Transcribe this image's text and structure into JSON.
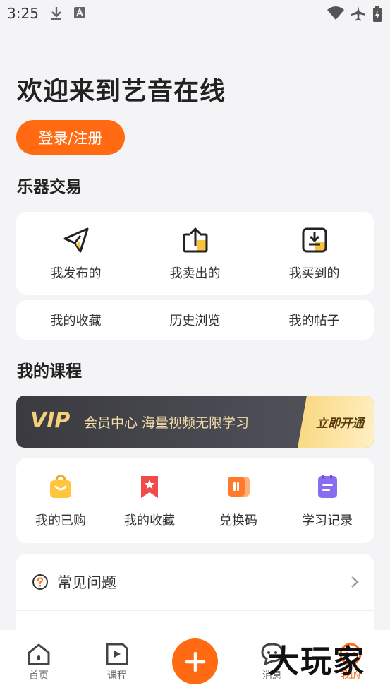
{
  "status_bar": {
    "time": "3:25"
  },
  "header": {
    "welcome": "欢迎来到艺音在线",
    "login_label": "登录/注册"
  },
  "trade": {
    "title": "乐器交易",
    "items": [
      {
        "label": "我发布的",
        "icon": "send-icon"
      },
      {
        "label": "我卖出的",
        "icon": "upload-box-icon"
      },
      {
        "label": "我买到的",
        "icon": "download-box-icon"
      }
    ],
    "links": [
      {
        "label": "我的收藏"
      },
      {
        "label": "历史浏览"
      },
      {
        "label": "我的帖子"
      }
    ]
  },
  "courses": {
    "title": "我的课程",
    "vip": {
      "logo": "VIP",
      "text": "会员中心 海量视频无限学习",
      "cta": "立即开通"
    },
    "items": [
      {
        "label": "我的已购",
        "icon": "shopping-bag-icon"
      },
      {
        "label": "我的收藏",
        "icon": "bookmark-star-icon"
      },
      {
        "label": "兑换码",
        "icon": "coupon-icon"
      },
      {
        "label": "学习记录",
        "icon": "notebook-icon"
      }
    ]
  },
  "faq": {
    "label": "常见问题"
  },
  "tabbar": {
    "tabs": [
      {
        "label": "首页",
        "icon": "home-icon"
      },
      {
        "label": "课程",
        "icon": "play-doc-icon"
      },
      {
        "label": "消息",
        "icon": "chat-icon"
      },
      {
        "label": "我的",
        "icon": "profile-face-icon"
      }
    ],
    "active_index": 3
  },
  "watermark": "大玩家",
  "colors": {
    "accent": "#ff6a13",
    "background": "#f4f4f6",
    "vip_gold": "#f5cf7a"
  }
}
